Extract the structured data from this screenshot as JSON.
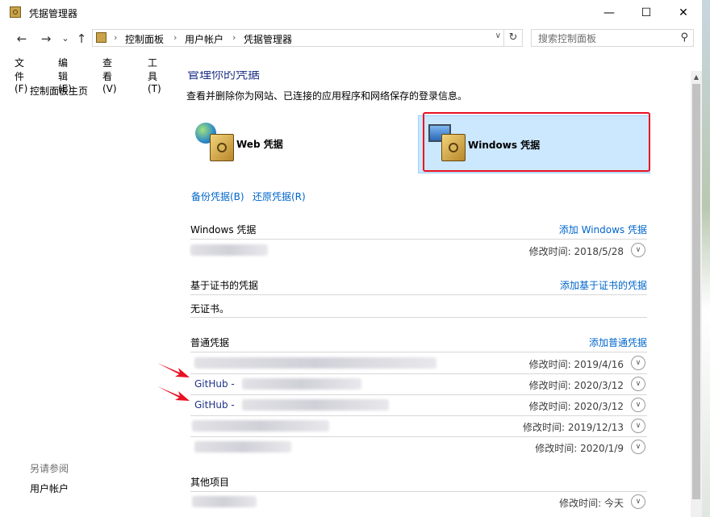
{
  "window": {
    "title": "凭据管理器",
    "minimize": "—",
    "maximize": "☐",
    "close": "✕"
  },
  "nav": {
    "back": "←",
    "forward": "→",
    "recent": "⌄",
    "up": "↑",
    "breadcrumbs": [
      "控制面板",
      "用户帐户",
      "凭据管理器"
    ],
    "search_placeholder": "搜索控制面板"
  },
  "menu": [
    "文件(F)",
    "编辑(E)",
    "查看(V)",
    "工具(T)"
  ],
  "left_pane": {
    "home_link": "控制面板主页",
    "see_also": "另请参阅",
    "user_accounts": "用户帐户"
  },
  "main": {
    "heading": "管理你的凭据",
    "description": "查看并删除你为网站、已连接的应用程序和网络保存的登录信息。",
    "tiles": {
      "web": "Web 凭据",
      "windows": "Windows 凭据"
    },
    "backup": "备份凭据(B)",
    "restore": "还原凭据(R)",
    "windows_section": {
      "title": "Windows 凭据",
      "add": "添加 Windows 凭据",
      "rows": [
        {
          "modified": "修改时间: 2018/5/28"
        }
      ]
    },
    "cert_section": {
      "title": "基于证书的凭据",
      "add": "添加基于证书的凭据",
      "empty": "无证书。"
    },
    "generic_section": {
      "title": "普通凭据",
      "add": "添加普通凭据",
      "rows": [
        {
          "label": "",
          "modified": "修改时间: 2019/4/16"
        },
        {
          "label": "GitHub -",
          "modified": "修改时间: 2020/3/12"
        },
        {
          "label": "GitHub -",
          "modified": "修改时间: 2020/3/12"
        },
        {
          "label": "",
          "modified": "修改时间: 2019/12/13"
        },
        {
          "label": "",
          "modified": "修改时间: 2020/1/9"
        }
      ]
    },
    "other_section": {
      "title": "其他项目",
      "rows": [
        {
          "modified": "修改时间: 今天"
        }
      ]
    }
  },
  "colors": {
    "accent_link": "#0066cc",
    "heading": "#1e3287",
    "highlight": "#e81123",
    "selected_tile": "#cce8ff"
  }
}
